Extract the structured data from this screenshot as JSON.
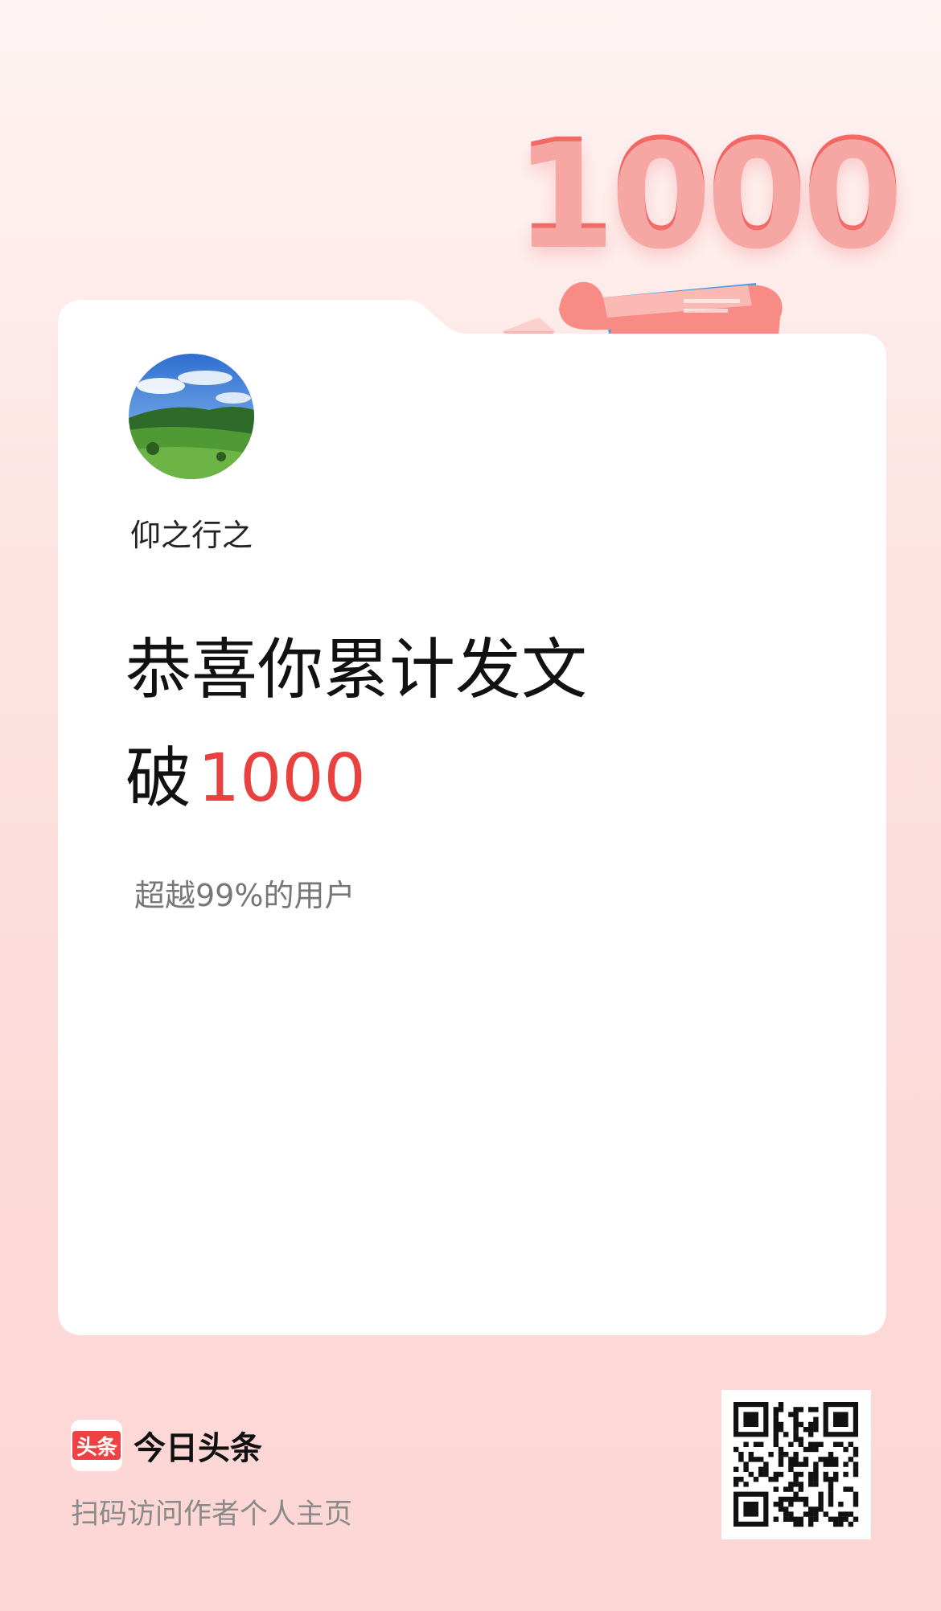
{
  "badge": {
    "number": "1000"
  },
  "profile": {
    "username": "仰之行之",
    "avatar_icon": "landscape-avatar"
  },
  "achievement": {
    "line1": "恭喜你累计发文",
    "line2_prefix": "破",
    "line2_number": "1000",
    "subtext": "超越99%的用户"
  },
  "footer": {
    "logo_text": "头条",
    "brand_name": "今日头条",
    "scan_hint": "扫码访问作者个人主页",
    "qr_icon": "qr-code"
  },
  "colors": {
    "accent": "#e8413f",
    "brand": "#f04142"
  }
}
